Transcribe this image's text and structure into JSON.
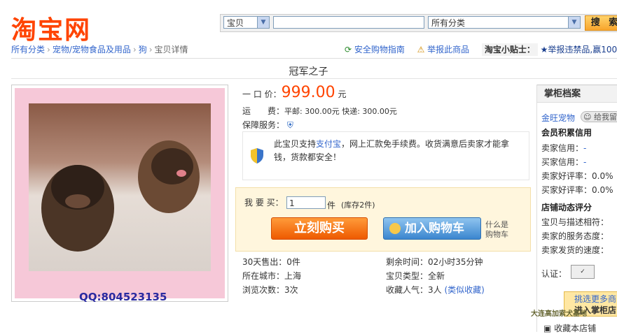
{
  "header": {
    "logo_text": "淘宝网",
    "search": {
      "type_select": "宝贝",
      "category_select": "所有分类",
      "button_label": "搜 索"
    }
  },
  "breadcrumb": {
    "items": [
      "所有分类",
      "宠物/宠物食品及用品",
      "狗",
      "宝贝详情"
    ]
  },
  "top_links": {
    "safe_guide": "安全购物指南",
    "report": "举报此商品",
    "tip_label": "淘宝小贴士：",
    "tip_text": "★举报违禁品,赢100"
  },
  "product": {
    "title": "冠军之子",
    "qq_text": "QQ:804523135",
    "price_label": "一 口 价：",
    "price": "999.00",
    "price_unit": "元",
    "shipping_label": "运　　费：",
    "shipping": "平邮: 300.00元 快递: 300.00元",
    "guarantee_label": "保障服务：",
    "notice": {
      "pre": "此宝贝支持",
      "link": "支付宝",
      "post": "，网上汇款免手续费。收货满意后卖家才能拿钱，货款都安全！"
    },
    "buy": {
      "qty_label": "我 要 买：",
      "qty_value": "1",
      "qty_unit": "件",
      "stock": "(库存2件)",
      "buy_now": "立刻购买",
      "add_cart": "加入购物车",
      "what_is_cart_line1": "什么是",
      "what_is_cart_line2": "购物车"
    },
    "stats": {
      "sold": "30天售出：0件",
      "remaining": "剩余时间：02小时35分钟",
      "city": "所在城市：上海",
      "type": "宝贝类型：全新",
      "views": "浏览次数：3次",
      "favorites": "收藏人气：3人",
      "similar": "(类似收藏)"
    }
  },
  "seller": {
    "heading": "掌柜档案",
    "name": "金旺宠物",
    "msg_button": "给我留",
    "credit_heading": "会员积累信用",
    "seller_credit": "卖家信用：",
    "seller_credit_val": "-",
    "buyer_credit": "买家信用：",
    "buyer_credit_val": "-",
    "seller_rate": "卖家好评率：0.0%",
    "buyer_rate": "买家好评率：0.0%",
    "dyn_heading": "店铺动态评分",
    "desc_match": "宝贝与描述相符：",
    "service": "卖家的服务态度：",
    "delivery": "卖家发货的速度：",
    "cert_label": "认证：",
    "pick_more": "挑选更多商",
    "enter_shop": "进入掌柜店",
    "fav_shop": "收藏本店铺"
  },
  "watermark": "大连高加索犬基地"
}
